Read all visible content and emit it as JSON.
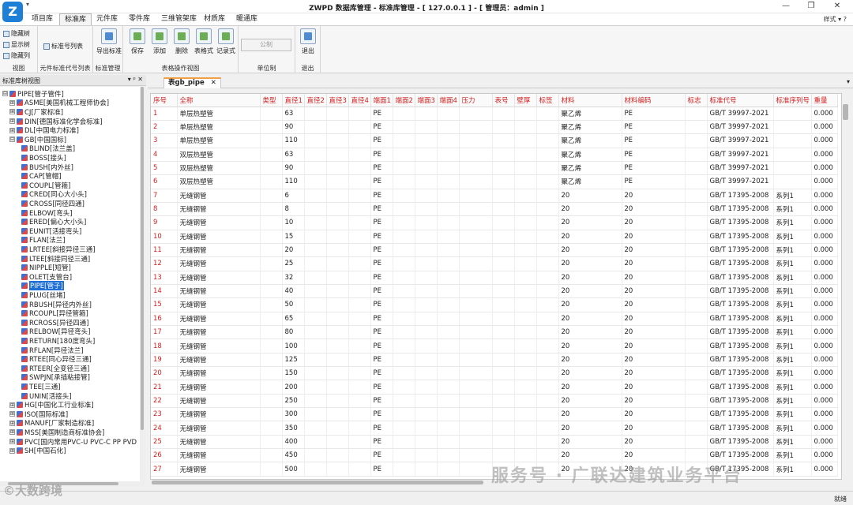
{
  "window": {
    "title": "ZWPD 数据库管理 - 标准库管理 - [ 127.0.0.1 ] - [ 管理员：admin ]",
    "quick_access": "▾",
    "minimize": "—",
    "restore": "❐",
    "close": "✕",
    "logo": "Z"
  },
  "ribbon_tabs": [
    "项目库",
    "标准库",
    "元件库",
    "零件库",
    "三维管架库",
    "材质库",
    "暖通库"
  ],
  "active_tab": "标准库",
  "style_label": "样式 ▾ ?",
  "ribbon": {
    "view": {
      "items": [
        "隐藏树",
        "显示树",
        "隐藏列"
      ],
      "label": "视图"
    },
    "std_list": {
      "item": "标准号列表",
      "label": "元件标准代号列表"
    },
    "std_mgmt": {
      "item": "导出标准",
      "label": "标准管理"
    },
    "table_ops": {
      "items": [
        "保存",
        "添加",
        "删除",
        "表格式",
        "记录式"
      ],
      "label": "表格操作视图"
    },
    "unit": {
      "item": "公制",
      "label": "单位制"
    },
    "exit": {
      "item": "退出",
      "label": "退出"
    }
  },
  "left_panel": {
    "title": "标准库树视图",
    "controls": "▾ ᵖ ✕"
  },
  "tree": [
    {
      "level": 0,
      "toggle": "⊟",
      "label": "PIPE[管子管件]"
    },
    {
      "level": 1,
      "toggle": "⊞",
      "label": "ASME[美国机械工程师协会]"
    },
    {
      "level": 1,
      "toggle": "⊞",
      "label": "CJ[厂家标准]"
    },
    {
      "level": 1,
      "toggle": "⊞",
      "label": "DIN[德国标准化学会标准]"
    },
    {
      "level": 1,
      "toggle": "⊞",
      "label": "DL[中国电力标准]"
    },
    {
      "level": 1,
      "toggle": "⊟",
      "label": "GB[中国国标]"
    },
    {
      "level": 2,
      "label": "BLIND[法兰盖]"
    },
    {
      "level": 2,
      "label": "BOSS[接头]"
    },
    {
      "level": 2,
      "label": "BUSH[内外丝]"
    },
    {
      "level": 2,
      "label": "CAP[管帽]"
    },
    {
      "level": 2,
      "label": "COUPL[管箍]"
    },
    {
      "level": 2,
      "label": "CRED[同心大小头]"
    },
    {
      "level": 2,
      "label": "CROSS[同径四通]"
    },
    {
      "level": 2,
      "label": "ELBOW[弯头]"
    },
    {
      "level": 2,
      "label": "ERED[偏心大小头]"
    },
    {
      "level": 2,
      "label": "EUNIT[活接弯头]"
    },
    {
      "level": 2,
      "label": "FLAN[法兰]"
    },
    {
      "level": 2,
      "label": "LRTEE[斜接异径三通]"
    },
    {
      "level": 2,
      "label": "LTEE[斜接同径三通]"
    },
    {
      "level": 2,
      "label": "NIPPLE[短管]"
    },
    {
      "level": 2,
      "label": "OLET[支管台]"
    },
    {
      "level": 2,
      "label": "PIPE[管子]",
      "selected": true
    },
    {
      "level": 2,
      "label": "PLUG[丝堵]"
    },
    {
      "level": 2,
      "label": "RBUSH[异径内外丝]"
    },
    {
      "level": 2,
      "label": "RCOUPL[异径管箍]"
    },
    {
      "level": 2,
      "label": "RCROSS[异径四通]"
    },
    {
      "level": 2,
      "label": "RELBOW[异径弯头]"
    },
    {
      "level": 2,
      "label": "RETURN[180度弯头]"
    },
    {
      "level": 2,
      "label": "RFLAN[异径法兰]"
    },
    {
      "level": 2,
      "label": "RTEE[同心异径三通]"
    },
    {
      "level": 2,
      "label": "RTEER[全变径三通]"
    },
    {
      "level": 2,
      "label": "SWPJN[承插粘接管]"
    },
    {
      "level": 2,
      "label": "TEE[三通]"
    },
    {
      "level": 2,
      "label": "UNIN[活接头]"
    },
    {
      "level": 1,
      "toggle": "⊞",
      "label": "HG[中国化工行业标准]"
    },
    {
      "level": 1,
      "toggle": "⊞",
      "label": "ISO[国际标准]"
    },
    {
      "level": 1,
      "toggle": "⊞",
      "label": "MANUF[厂家制造标准]"
    },
    {
      "level": 1,
      "toggle": "⊞",
      "label": "MSS[美国制造商标准协会]"
    },
    {
      "level": 1,
      "toggle": "⊞",
      "label": "PVC[国内常用PVC-U PVC-C PP PVD"
    },
    {
      "level": 1,
      "toggle": "⊞",
      "label": "SH[中国石化]"
    }
  ],
  "doc_tab": {
    "label": "表gb_pipe",
    "close": "✕",
    "menu": "▾"
  },
  "grid": {
    "columns": [
      "序号",
      "全称",
      "类型",
      "直径1",
      "直径2",
      "直径3",
      "直径4",
      "端面1",
      "端面2",
      "端面3",
      "端面4",
      "压力",
      "表号",
      "壁厚",
      "标签",
      "材料",
      "材料编码",
      "标志",
      "标准代号",
      "标准序列号",
      "重量"
    ],
    "rows": [
      [
        "1",
        "单层热塑管",
        "",
        "63",
        "",
        "",
        "",
        "PE",
        "",
        "",
        "",
        "",
        "",
        "",
        "",
        "聚乙烯",
        "PE",
        "",
        "GB/T 39997-2021",
        "",
        "0.000"
      ],
      [
        "2",
        "单层热塑管",
        "",
        "90",
        "",
        "",
        "",
        "PE",
        "",
        "",
        "",
        "",
        "",
        "",
        "",
        "聚乙烯",
        "PE",
        "",
        "GB/T 39997-2021",
        "",
        "0.000"
      ],
      [
        "3",
        "单层热塑管",
        "",
        "110",
        "",
        "",
        "",
        "PE",
        "",
        "",
        "",
        "",
        "",
        "",
        "",
        "聚乙烯",
        "PE",
        "",
        "GB/T 39997-2021",
        "",
        "0.000"
      ],
      [
        "4",
        "双层热塑管",
        "",
        "63",
        "",
        "",
        "",
        "PE",
        "",
        "",
        "",
        "",
        "",
        "",
        "",
        "聚乙烯",
        "PE",
        "",
        "GB/T 39997-2021",
        "",
        "0.000"
      ],
      [
        "5",
        "双层热塑管",
        "",
        "90",
        "",
        "",
        "",
        "PE",
        "",
        "",
        "",
        "",
        "",
        "",
        "",
        "聚乙烯",
        "PE",
        "",
        "GB/T 39997-2021",
        "",
        "0.000"
      ],
      [
        "6",
        "双层热塑管",
        "",
        "110",
        "",
        "",
        "",
        "PE",
        "",
        "",
        "",
        "",
        "",
        "",
        "",
        "聚乙烯",
        "PE",
        "",
        "GB/T 39997-2021",
        "",
        "0.000"
      ],
      [
        "7",
        "无缝钢管",
        "",
        "6",
        "",
        "",
        "",
        "PE",
        "",
        "",
        "",
        "",
        "",
        "",
        "",
        "20",
        "20",
        "",
        "GB/T 17395-2008",
        "系列1",
        "0.000"
      ],
      [
        "8",
        "无缝钢管",
        "",
        "8",
        "",
        "",
        "",
        "PE",
        "",
        "",
        "",
        "",
        "",
        "",
        "",
        "20",
        "20",
        "",
        "GB/T 17395-2008",
        "系列1",
        "0.000"
      ],
      [
        "9",
        "无缝钢管",
        "",
        "10",
        "",
        "",
        "",
        "PE",
        "",
        "",
        "",
        "",
        "",
        "",
        "",
        "20",
        "20",
        "",
        "GB/T 17395-2008",
        "系列1",
        "0.000"
      ],
      [
        "10",
        "无缝钢管",
        "",
        "15",
        "",
        "",
        "",
        "PE",
        "",
        "",
        "",
        "",
        "",
        "",
        "",
        "20",
        "20",
        "",
        "GB/T 17395-2008",
        "系列1",
        "0.000"
      ],
      [
        "11",
        "无缝钢管",
        "",
        "20",
        "",
        "",
        "",
        "PE",
        "",
        "",
        "",
        "",
        "",
        "",
        "",
        "20",
        "20",
        "",
        "GB/T 17395-2008",
        "系列1",
        "0.000"
      ],
      [
        "12",
        "无缝钢管",
        "",
        "25",
        "",
        "",
        "",
        "PE",
        "",
        "",
        "",
        "",
        "",
        "",
        "",
        "20",
        "20",
        "",
        "GB/T 17395-2008",
        "系列1",
        "0.000"
      ],
      [
        "13",
        "无缝钢管",
        "",
        "32",
        "",
        "",
        "",
        "PE",
        "",
        "",
        "",
        "",
        "",
        "",
        "",
        "20",
        "20",
        "",
        "GB/T 17395-2008",
        "系列1",
        "0.000"
      ],
      [
        "14",
        "无缝钢管",
        "",
        "40",
        "",
        "",
        "",
        "PE",
        "",
        "",
        "",
        "",
        "",
        "",
        "",
        "20",
        "20",
        "",
        "GB/T 17395-2008",
        "系列1",
        "0.000"
      ],
      [
        "15",
        "无缝钢管",
        "",
        "50",
        "",
        "",
        "",
        "PE",
        "",
        "",
        "",
        "",
        "",
        "",
        "",
        "20",
        "20",
        "",
        "GB/T 17395-2008",
        "系列1",
        "0.000"
      ],
      [
        "16",
        "无缝钢管",
        "",
        "65",
        "",
        "",
        "",
        "PE",
        "",
        "",
        "",
        "",
        "",
        "",
        "",
        "20",
        "20",
        "",
        "GB/T 17395-2008",
        "系列1",
        "0.000"
      ],
      [
        "17",
        "无缝钢管",
        "",
        "80",
        "",
        "",
        "",
        "PE",
        "",
        "",
        "",
        "",
        "",
        "",
        "",
        "20",
        "20",
        "",
        "GB/T 17395-2008",
        "系列1",
        "0.000"
      ],
      [
        "18",
        "无缝钢管",
        "",
        "100",
        "",
        "",
        "",
        "PE",
        "",
        "",
        "",
        "",
        "",
        "",
        "",
        "20",
        "20",
        "",
        "GB/T 17395-2008",
        "系列1",
        "0.000"
      ],
      [
        "19",
        "无缝钢管",
        "",
        "125",
        "",
        "",
        "",
        "PE",
        "",
        "",
        "",
        "",
        "",
        "",
        "",
        "20",
        "20",
        "",
        "GB/T 17395-2008",
        "系列1",
        "0.000"
      ],
      [
        "20",
        "无缝钢管",
        "",
        "150",
        "",
        "",
        "",
        "PE",
        "",
        "",
        "",
        "",
        "",
        "",
        "",
        "20",
        "20",
        "",
        "GB/T 17395-2008",
        "系列1",
        "0.000"
      ],
      [
        "21",
        "无缝钢管",
        "",
        "200",
        "",
        "",
        "",
        "PE",
        "",
        "",
        "",
        "",
        "",
        "",
        "",
        "20",
        "20",
        "",
        "GB/T 17395-2008",
        "系列1",
        "0.000"
      ],
      [
        "22",
        "无缝钢管",
        "",
        "250",
        "",
        "",
        "",
        "PE",
        "",
        "",
        "",
        "",
        "",
        "",
        "",
        "20",
        "20",
        "",
        "GB/T 17395-2008",
        "系列1",
        "0.000"
      ],
      [
        "23",
        "无缝钢管",
        "",
        "300",
        "",
        "",
        "",
        "PE",
        "",
        "",
        "",
        "",
        "",
        "",
        "",
        "20",
        "20",
        "",
        "GB/T 17395-2008",
        "系列1",
        "0.000"
      ],
      [
        "24",
        "无缝钢管",
        "",
        "350",
        "",
        "",
        "",
        "PE",
        "",
        "",
        "",
        "",
        "",
        "",
        "",
        "20",
        "20",
        "",
        "GB/T 17395-2008",
        "系列1",
        "0.000"
      ],
      [
        "25",
        "无缝钢管",
        "",
        "400",
        "",
        "",
        "",
        "PE",
        "",
        "",
        "",
        "",
        "",
        "",
        "",
        "20",
        "20",
        "",
        "GB/T 17395-2008",
        "系列1",
        "0.000"
      ],
      [
        "26",
        "无缝钢管",
        "",
        "450",
        "",
        "",
        "",
        "PE",
        "",
        "",
        "",
        "",
        "",
        "",
        "",
        "20",
        "20",
        "",
        "GB/T 17395-2008",
        "系列1",
        "0.000"
      ],
      [
        "27",
        "无缝钢管",
        "",
        "500",
        "",
        "",
        "",
        "PE",
        "",
        "",
        "",
        "",
        "",
        "",
        "",
        "20",
        "20",
        "",
        "GB/T 17395-2008",
        "系列1",
        "0.000"
      ]
    ]
  },
  "status": {
    "ready": "就绪"
  },
  "watermarks": {
    "left": "©大数跨境",
    "right": "服务号 · 广联达建筑业务平台"
  },
  "colors": {
    "header_text": "#d21f1f",
    "selection": "#1f6fd6",
    "tab_accent": "#f0a040"
  }
}
